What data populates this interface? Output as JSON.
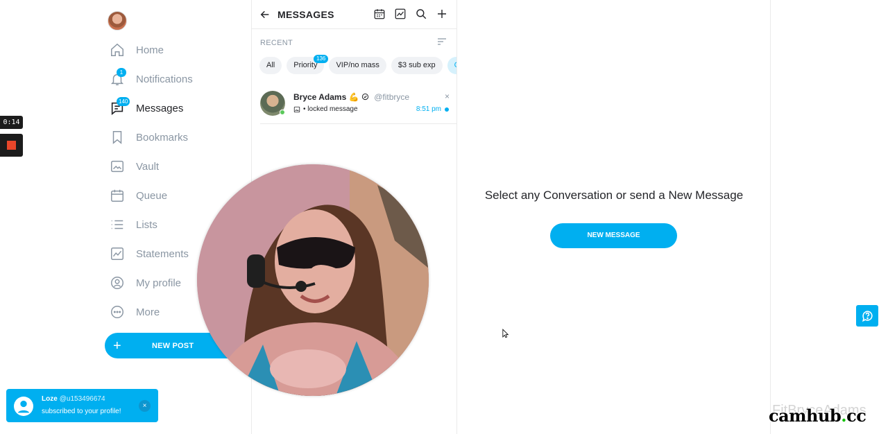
{
  "sidebar": {
    "items": [
      {
        "label": "Home",
        "icon": "home-icon"
      },
      {
        "label": "Notifications",
        "icon": "bell-icon",
        "badge": "1"
      },
      {
        "label": "Messages",
        "icon": "message-icon",
        "badge": "140",
        "active": true
      },
      {
        "label": "Bookmarks",
        "icon": "bookmark-icon"
      },
      {
        "label": "Vault",
        "icon": "vault-icon"
      },
      {
        "label": "Queue",
        "icon": "calendar-icon"
      },
      {
        "label": "Lists",
        "icon": "list-icon"
      },
      {
        "label": "Statements",
        "icon": "chart-icon"
      },
      {
        "label": "My profile",
        "icon": "profile-icon"
      },
      {
        "label": "More",
        "icon": "more-icon"
      }
    ],
    "new_post_label": "NEW POST"
  },
  "messages": {
    "title": "MESSAGES",
    "recent_label": "RECENT",
    "chips": [
      {
        "label": "All"
      },
      {
        "label": "Priority",
        "badge": "136"
      },
      {
        "label": "VIP/no mass"
      },
      {
        "label": "$3 sub exp"
      },
      {
        "label": "Cl"
      }
    ],
    "conversation": {
      "name": "Bryce Adams 💪",
      "handle": "@fitbryce",
      "preview": "• locked message",
      "time": "8:51 pm",
      "close": "×"
    }
  },
  "empty_state": {
    "title": "Select any Conversation or send a New Message",
    "button": "NEW MESSAGE"
  },
  "recording": {
    "timer": "0:14"
  },
  "toast": {
    "name": "Loze",
    "handle": "@u153496674",
    "message": "subscribed to your profile!",
    "close": "×"
  },
  "watermark": {
    "faint": "FitBryceAdams",
    "main": "camhub",
    "dot": ".",
    "tld": "cc"
  },
  "colors": {
    "accent": "#00aff0",
    "muted": "#8a96a3",
    "text": "#242529"
  }
}
